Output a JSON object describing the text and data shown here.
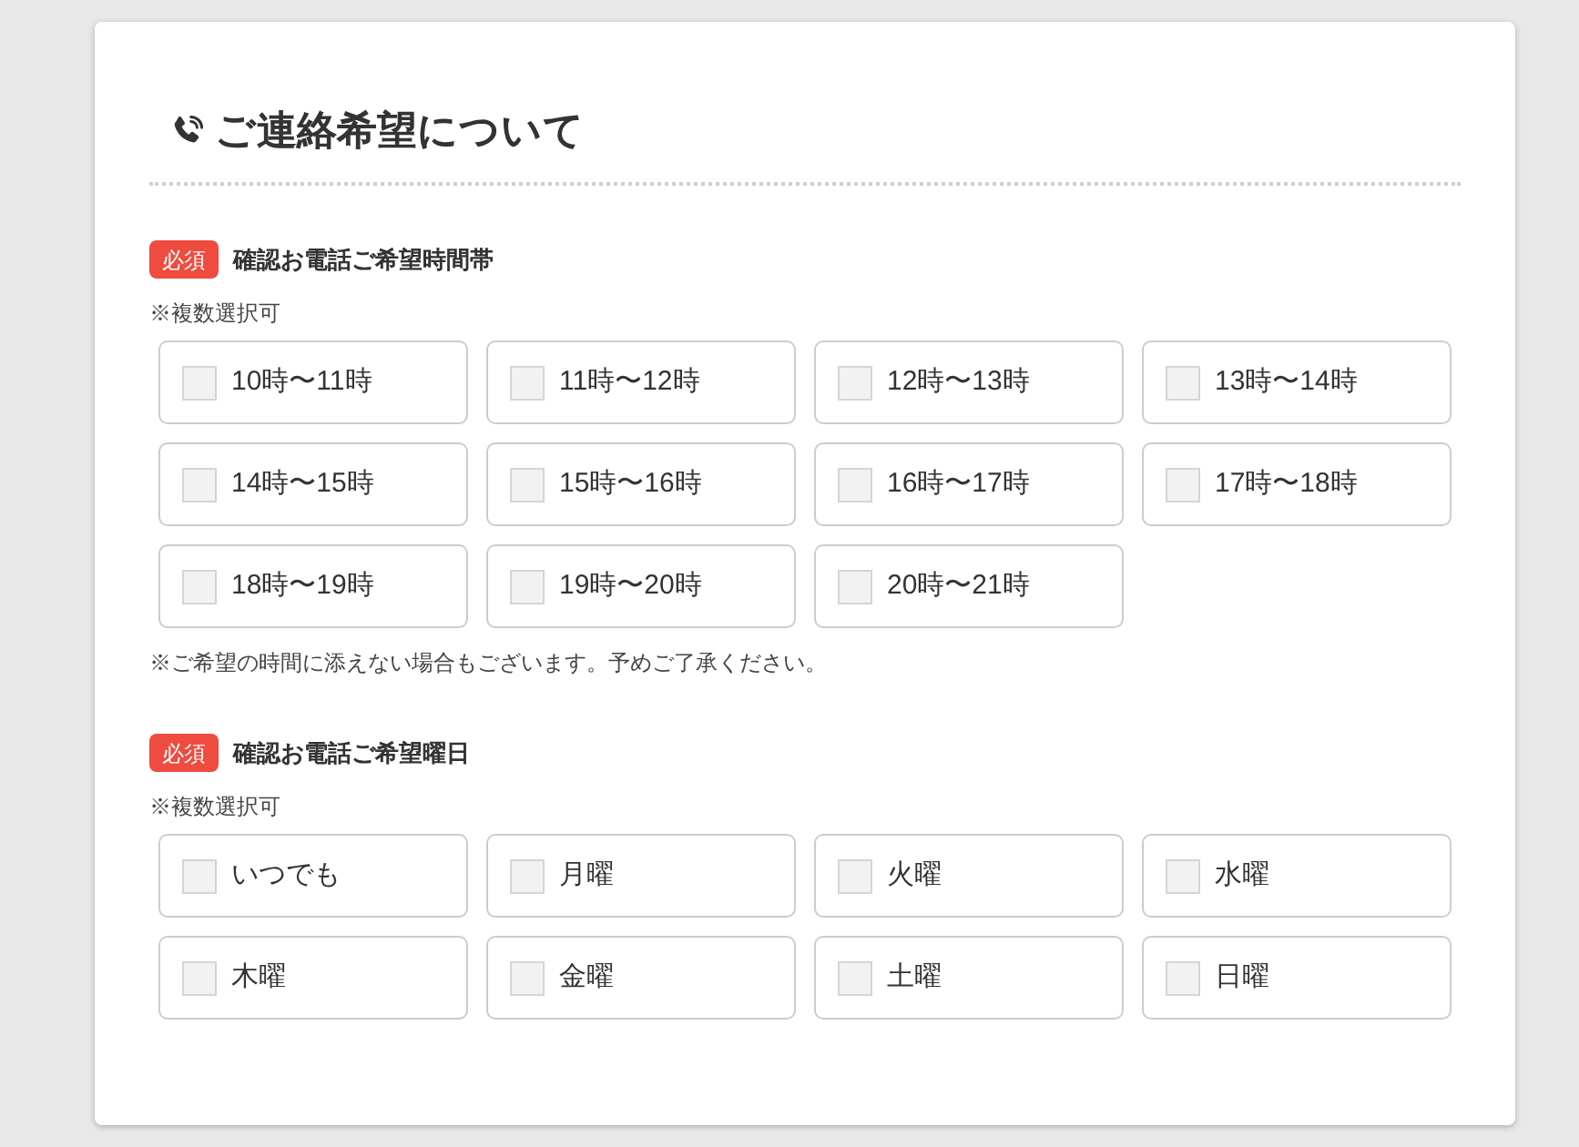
{
  "title": "ご連絡希望について",
  "sections": [
    {
      "badge": "必須",
      "label": "確認お電話ご希望時間帯",
      "note": "※複数選択可",
      "options": [
        {
          "label": "10時〜11時",
          "checked": false
        },
        {
          "label": "11時〜12時",
          "checked": false
        },
        {
          "label": "12時〜13時",
          "checked": false
        },
        {
          "label": "13時〜14時",
          "checked": false
        },
        {
          "label": "14時〜15時",
          "checked": false
        },
        {
          "label": "15時〜16時",
          "checked": false
        },
        {
          "label": "16時〜17時",
          "checked": false
        },
        {
          "label": "17時〜18時",
          "checked": false
        },
        {
          "label": "18時〜19時",
          "checked": false
        },
        {
          "label": "19時〜20時",
          "checked": false
        },
        {
          "label": "20時〜21時",
          "checked": false
        }
      ],
      "footnote": "※ご希望の時間に添えない場合もございます。予めご了承ください。"
    },
    {
      "badge": "必須",
      "label": "確認お電話ご希望曜日",
      "note": "※複数選択可",
      "options": [
        {
          "label": "いつでも",
          "checked": false
        },
        {
          "label": "月曜",
          "checked": false
        },
        {
          "label": "火曜",
          "checked": false
        },
        {
          "label": "水曜",
          "checked": false
        },
        {
          "label": "木曜",
          "checked": false
        },
        {
          "label": "金曜",
          "checked": false
        },
        {
          "label": "土曜",
          "checked": false
        },
        {
          "label": "日曜",
          "checked": false
        }
      ]
    }
  ]
}
